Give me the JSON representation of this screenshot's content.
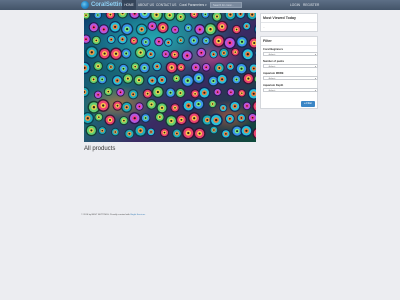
{
  "navbar": {
    "brand": "CoralSettings",
    "items": [
      {
        "label": "HOME",
        "active": true
      },
      {
        "label": "ABOUT US",
        "active": false
      },
      {
        "label": "CONTACT US",
        "active": false
      },
      {
        "label": "Coral Parameters ▾",
        "active": false
      }
    ],
    "search_placeholder": "Search for coral...",
    "right_items": [
      "LOGIN",
      "REGISTER"
    ]
  },
  "hero": {
    "image": "coral-reef-photo"
  },
  "most_viewed": {
    "title": "Most Viewed Today",
    "content": "..."
  },
  "filter": {
    "title": "Filter",
    "fields": [
      {
        "label": "Coral Beginners",
        "value": "-Select-"
      },
      {
        "label": "Number of packs",
        "value": "-Select-"
      },
      {
        "label": "Aquarium MDRE",
        "value": "-Select-"
      },
      {
        "label": "Aquarium Depth",
        "value": "-Select-"
      }
    ],
    "button": "Filter"
  },
  "main": {
    "section_title": "All products"
  },
  "footer": {
    "text": "© 2016 by BEST SETTINGS. Proudly created with ",
    "link": "Bright Services"
  },
  "colors": {
    "navbar": "#4e6079",
    "accent": "#3b86c6",
    "background": "#ecedf1"
  }
}
